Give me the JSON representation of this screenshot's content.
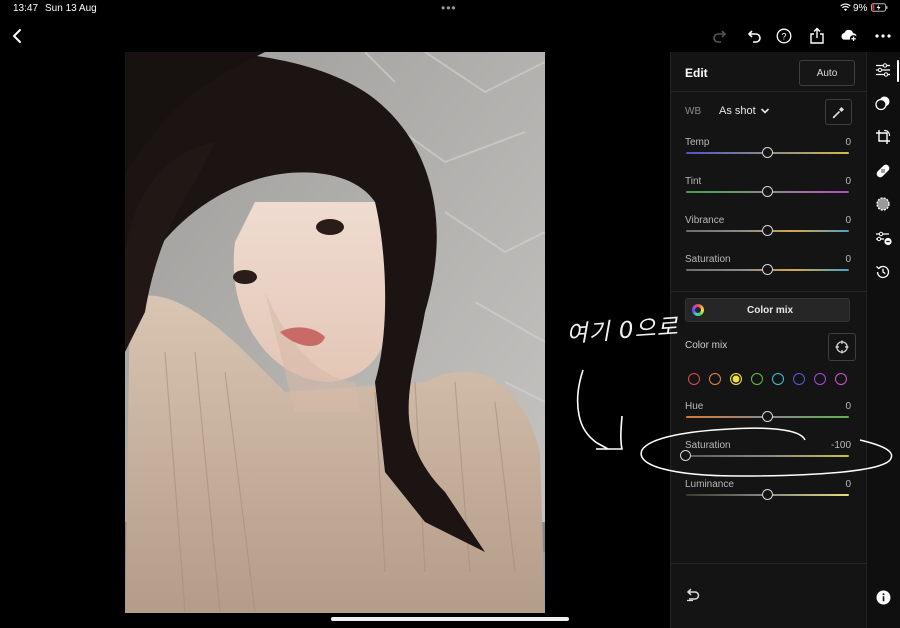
{
  "status_bar": {
    "time": "13:47",
    "date": "Sun 13 Aug",
    "battery": "9%"
  },
  "top_toolbar": {
    "icons": [
      "back-chevron-icon",
      "redo-icon",
      "undo-icon",
      "help-icon",
      "share-icon",
      "cloud-sync-icon",
      "more-icon"
    ]
  },
  "panel": {
    "title": "Edit",
    "auto_label": "Auto",
    "wb_label": "WB",
    "wb_value": "As shot",
    "sliders": [
      {
        "label": "Temp",
        "value": "0",
        "level": 0.5
      },
      {
        "label": "Tint",
        "value": "0",
        "level": 0.5
      },
      {
        "label": "Vibrance",
        "value": "0",
        "level": 0.5
      },
      {
        "label": "Saturation",
        "value": "0",
        "level": 0.5
      }
    ],
    "color_mix_button": "Color mix",
    "color_mix_label": "Color mix",
    "swatches": [
      "#e24b4b",
      "#e8883a",
      "#f0e040",
      "#63c04a",
      "#3fc6d6",
      "#4f61d8",
      "#a74ce0",
      "#d84fd8"
    ],
    "selected_swatch": 2,
    "mix_sliders": [
      {
        "label": "Hue",
        "value": "0",
        "level": 0.5
      },
      {
        "label": "Saturation",
        "value": "-100",
        "level": 0.0
      },
      {
        "label": "Luminance",
        "value": "0",
        "level": 0.5
      }
    ]
  },
  "right_rail": {
    "icons": [
      "edit-sliders-icon",
      "presets-icon",
      "crop-icon",
      "healing-icon",
      "masking-icon",
      "versions-icon",
      "history-icon",
      "info-icon"
    ]
  },
  "annotation": {
    "text": "여기 0으로"
  },
  "colors": {
    "accent": "#ffffff",
    "panel_bg": "#141414",
    "ink": "#ffffff"
  }
}
